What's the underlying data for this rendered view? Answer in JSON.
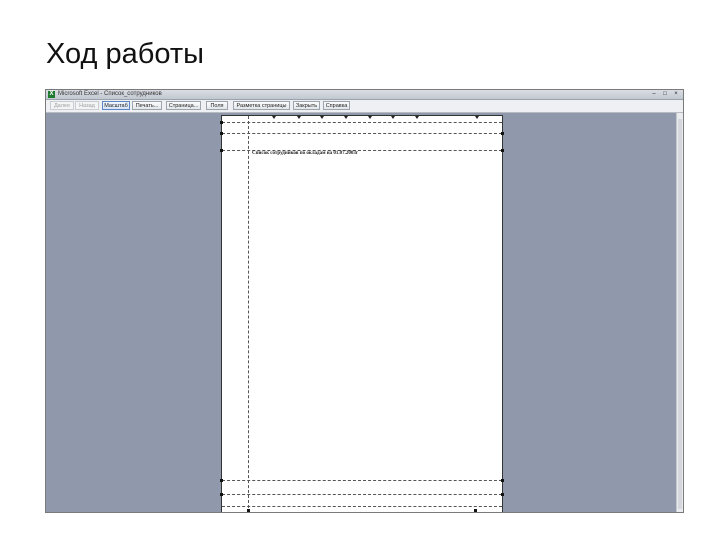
{
  "slide": {
    "title": "Ход работы"
  },
  "window": {
    "title": "Microsoft Excel - Список_сотрудников",
    "app_icon": "excel-icon",
    "controls": {
      "minimize": "–",
      "maximize": "□",
      "close": "×"
    }
  },
  "toolbar": {
    "buttons": [
      {
        "label": "Далее",
        "state": "disabled"
      },
      {
        "label": "Назад",
        "state": "disabled"
      },
      {
        "label": "Масштаб",
        "state": "active"
      },
      {
        "label": "Печать...",
        "state": "normal"
      },
      {
        "label": "Страница...",
        "state": "normal"
      },
      {
        "label": "Поля",
        "state": "normal"
      },
      {
        "label": "Разметка страницы",
        "state": "normal"
      },
      {
        "label": "Закрыть",
        "state": "normal"
      },
      {
        "label": "Справка",
        "state": "normal"
      }
    ]
  },
  "page": {
    "heading": "Список сотрудников по окладам на 01.07.2003г"
  },
  "colors": {
    "workspace": "#8f99ab",
    "page": "#ffffff",
    "toolbar": "#eef0f3"
  }
}
